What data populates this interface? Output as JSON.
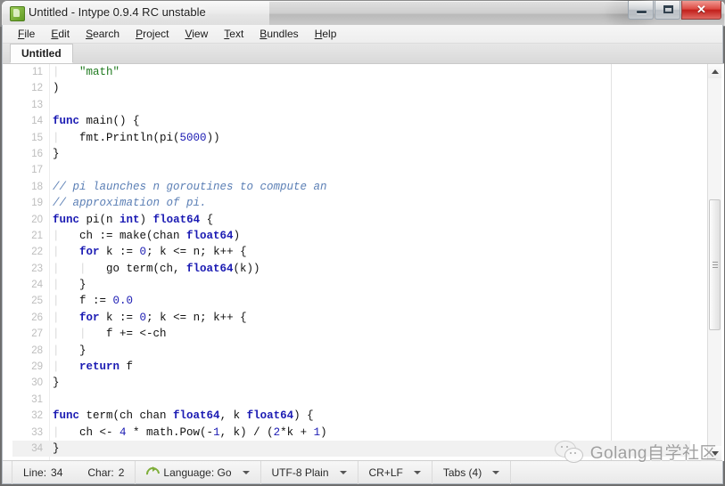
{
  "window": {
    "title": "Untitled - Intype 0.9.4 RC unstable",
    "app_icon": "intype-app-icon",
    "controls": {
      "minimize": "minimize-icon",
      "maximize": "maximize-icon",
      "close": "✕"
    }
  },
  "menubar": {
    "items": [
      {
        "label": "File",
        "accel": "F"
      },
      {
        "label": "Edit",
        "accel": "E"
      },
      {
        "label": "Search",
        "accel": "S"
      },
      {
        "label": "Project",
        "accel": "P"
      },
      {
        "label": "View",
        "accel": "V"
      },
      {
        "label": "Text",
        "accel": "T"
      },
      {
        "label": "Bundles",
        "accel": "B"
      },
      {
        "label": "Help",
        "accel": "H"
      }
    ]
  },
  "tabs": [
    {
      "label": "Untitled",
      "active": true
    }
  ],
  "editor": {
    "first_line": 11,
    "current_line": 34,
    "lines": [
      {
        "n": 11,
        "tokens": [
          {
            "t": "\t",
            "c": "ind"
          },
          {
            "t": "\"math\"",
            "c": "str"
          }
        ]
      },
      {
        "n": 12,
        "tokens": [
          {
            "t": ")",
            "c": ""
          }
        ]
      },
      {
        "n": 13,
        "tokens": []
      },
      {
        "n": 14,
        "tokens": [
          {
            "t": "func",
            "c": "kw"
          },
          {
            "t": " main() {",
            "c": ""
          }
        ]
      },
      {
        "n": 15,
        "tokens": [
          {
            "t": "\t",
            "c": "ind"
          },
          {
            "t": "fmt.Println(pi(",
            "c": ""
          },
          {
            "t": "5000",
            "c": "num"
          },
          {
            "t": "))",
            "c": ""
          }
        ]
      },
      {
        "n": 16,
        "tokens": [
          {
            "t": "}",
            "c": ""
          }
        ]
      },
      {
        "n": 17,
        "tokens": []
      },
      {
        "n": 18,
        "tokens": [
          {
            "t": "// pi launches n goroutines to compute an",
            "c": "cm"
          }
        ]
      },
      {
        "n": 19,
        "tokens": [
          {
            "t": "// approximation of pi.",
            "c": "cm"
          }
        ]
      },
      {
        "n": 20,
        "tokens": [
          {
            "t": "func",
            "c": "kw"
          },
          {
            "t": " pi(n ",
            "c": ""
          },
          {
            "t": "int",
            "c": "ty"
          },
          {
            "t": ") ",
            "c": ""
          },
          {
            "t": "float64",
            "c": "ty"
          },
          {
            "t": " {",
            "c": ""
          }
        ]
      },
      {
        "n": 21,
        "tokens": [
          {
            "t": "\t",
            "c": "ind"
          },
          {
            "t": "ch := make(chan ",
            "c": ""
          },
          {
            "t": "float64",
            "c": "ty"
          },
          {
            "t": ")",
            "c": ""
          }
        ]
      },
      {
        "n": 22,
        "tokens": [
          {
            "t": "\t",
            "c": "ind"
          },
          {
            "t": "for",
            "c": "kw"
          },
          {
            "t": " k := ",
            "c": ""
          },
          {
            "t": "0",
            "c": "num"
          },
          {
            "t": "; k <= n; k++ {",
            "c": ""
          }
        ]
      },
      {
        "n": 23,
        "tokens": [
          {
            "t": "\t\t",
            "c": "ind"
          },
          {
            "t": "go term(ch, ",
            "c": ""
          },
          {
            "t": "float64",
            "c": "ty"
          },
          {
            "t": "(k))",
            "c": ""
          }
        ]
      },
      {
        "n": 24,
        "tokens": [
          {
            "t": "\t",
            "c": "ind"
          },
          {
            "t": "}",
            "c": ""
          }
        ]
      },
      {
        "n": 25,
        "tokens": [
          {
            "t": "\t",
            "c": "ind"
          },
          {
            "t": "f := ",
            "c": ""
          },
          {
            "t": "0.0",
            "c": "num"
          }
        ]
      },
      {
        "n": 26,
        "tokens": [
          {
            "t": "\t",
            "c": "ind"
          },
          {
            "t": "for",
            "c": "kw"
          },
          {
            "t": " k := ",
            "c": ""
          },
          {
            "t": "0",
            "c": "num"
          },
          {
            "t": "; k <= n; k++ {",
            "c": ""
          }
        ]
      },
      {
        "n": 27,
        "tokens": [
          {
            "t": "\t\t",
            "c": "ind"
          },
          {
            "t": "f += <-ch",
            "c": ""
          }
        ]
      },
      {
        "n": 28,
        "tokens": [
          {
            "t": "\t",
            "c": "ind"
          },
          {
            "t": "}",
            "c": ""
          }
        ]
      },
      {
        "n": 29,
        "tokens": [
          {
            "t": "\t",
            "c": "ind"
          },
          {
            "t": "return",
            "c": "kw"
          },
          {
            "t": " f",
            "c": ""
          }
        ]
      },
      {
        "n": 30,
        "tokens": [
          {
            "t": "}",
            "c": ""
          }
        ]
      },
      {
        "n": 31,
        "tokens": []
      },
      {
        "n": 32,
        "tokens": [
          {
            "t": "func",
            "c": "kw"
          },
          {
            "t": " term(ch chan ",
            "c": ""
          },
          {
            "t": "float64",
            "c": "ty"
          },
          {
            "t": ", k ",
            "c": ""
          },
          {
            "t": "float64",
            "c": "ty"
          },
          {
            "t": ") {",
            "c": ""
          }
        ]
      },
      {
        "n": 33,
        "tokens": [
          {
            "t": "\t",
            "c": "ind"
          },
          {
            "t": "ch <- ",
            "c": ""
          },
          {
            "t": "4",
            "c": "num"
          },
          {
            "t": " * math.Pow(-",
            "c": ""
          },
          {
            "t": "1",
            "c": "num"
          },
          {
            "t": ", k) / (",
            "c": ""
          },
          {
            "t": "2",
            "c": "num"
          },
          {
            "t": "*k + ",
            "c": ""
          },
          {
            "t": "1",
            "c": "num"
          },
          {
            "t": ")",
            "c": ""
          }
        ]
      },
      {
        "n": 34,
        "tokens": [
          {
            "t": "}",
            "c": ""
          }
        ]
      }
    ]
  },
  "scrollbar": {
    "up_arrow": "scroll-up-icon",
    "down_arrow": "scroll-down-icon"
  },
  "statusbar": {
    "line_label": "Line:",
    "line_value": "34",
    "char_label": "Char:",
    "char_value": "2",
    "language": "Language: Go",
    "language_icon": "sync-icon",
    "encoding": "UTF-8 Plain",
    "line_ending": "CR+LF",
    "tabs": "Tabs (4)"
  },
  "watermark": {
    "text": "Golang自学社区",
    "logo": "wechat-icon"
  },
  "colors": {
    "keyword": "#1b1bb3",
    "string": "#1f7a1f",
    "comment": "#5b7fb5",
    "number": "#1b1bb3",
    "accent_close": "#c21f1b"
  }
}
